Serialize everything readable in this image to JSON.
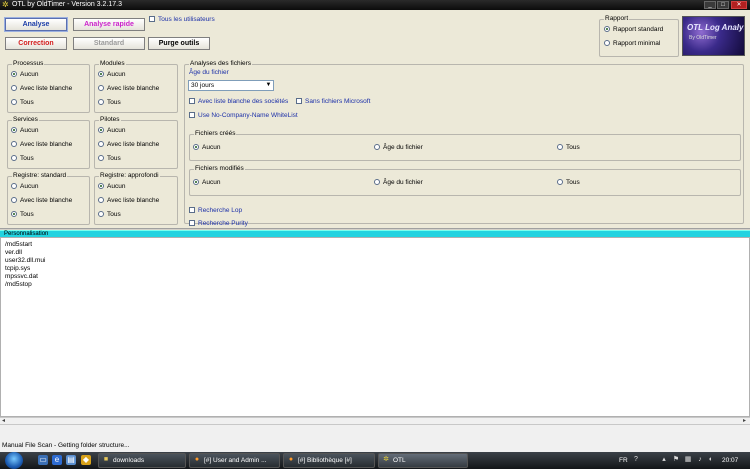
{
  "window": {
    "title": "OTL by OldTimer - Version 3.2.17.3"
  },
  "buttons": {
    "analyse": "Analyse",
    "analyse_rapide": "Analyse rapide",
    "correction": "Correction",
    "standard": "Standard",
    "purge_outils": "Purge outils"
  },
  "tous_utilisateurs": "Tous les utilisateurs",
  "rapport": {
    "title": "Rapport",
    "standard": "Rapport standard",
    "minimal": "Rapport minimal"
  },
  "logo": {
    "title": "OTL Log Analysis",
    "by": "By OldTimer"
  },
  "groups": {
    "processus": {
      "title": "Processus",
      "options": [
        "Aucun",
        "Avec liste blanche",
        "Tous"
      ]
    },
    "modules": {
      "title": "Modules",
      "options": [
        "Aucun",
        "Avec liste blanche",
        "Tous"
      ]
    },
    "services": {
      "title": "Services",
      "options": [
        "Aucun",
        "Avec liste blanche",
        "Tous"
      ]
    },
    "pilotes": {
      "title": "Pilotes",
      "options": [
        "Aucun",
        "Avec liste blanche",
        "Tous"
      ]
    },
    "registre_standard": {
      "title": "Registre: standard",
      "options": [
        "Aucun",
        "Avec liste blanche",
        "Tous"
      ]
    },
    "registre_approfondi": {
      "title": "Registre: approfondi",
      "options": [
        "Aucun",
        "Avec liste blanche",
        "Tous"
      ]
    }
  },
  "analyses": {
    "title": "Analyses des fichiers",
    "age_label": "Âge du fichier",
    "age_value": "30 jours",
    "check_liste_blanche": "Avec liste blanche des sociétés",
    "check_sans_microsoft": "Sans fichiers Microsoft",
    "check_no_company": "Use No-Company-Name WhiteList",
    "crees": {
      "title": "Fichiers créés",
      "options": [
        "Aucun",
        "Âge du fichier",
        "Tous"
      ]
    },
    "modifies": {
      "title": "Fichiers modifiés",
      "options": [
        "Aucun",
        "Âge du fichier",
        "Tous"
      ]
    },
    "recherche_lop": "Recherche Lop",
    "recherche_purity": "Recherche Purity"
  },
  "personnalisation": {
    "title": "Personnalisation",
    "lines": [
      "/md5start",
      "ver.dll",
      "user32.dll.mui",
      "tcpip.sys",
      "mpssvc.dat",
      "/md5stop"
    ]
  },
  "status": "Manual File Scan - Getting folder structure...",
  "taskbar": {
    "tasks": [
      "downloads",
      "[#] User and Admin ...",
      "[#] Bibliothèque [#]",
      "OTL"
    ],
    "lang": "FR",
    "clock": "20:07"
  },
  "colors": {
    "accent_cyan": "#22d3e0",
    "link_blue": "#1b2fa8"
  }
}
